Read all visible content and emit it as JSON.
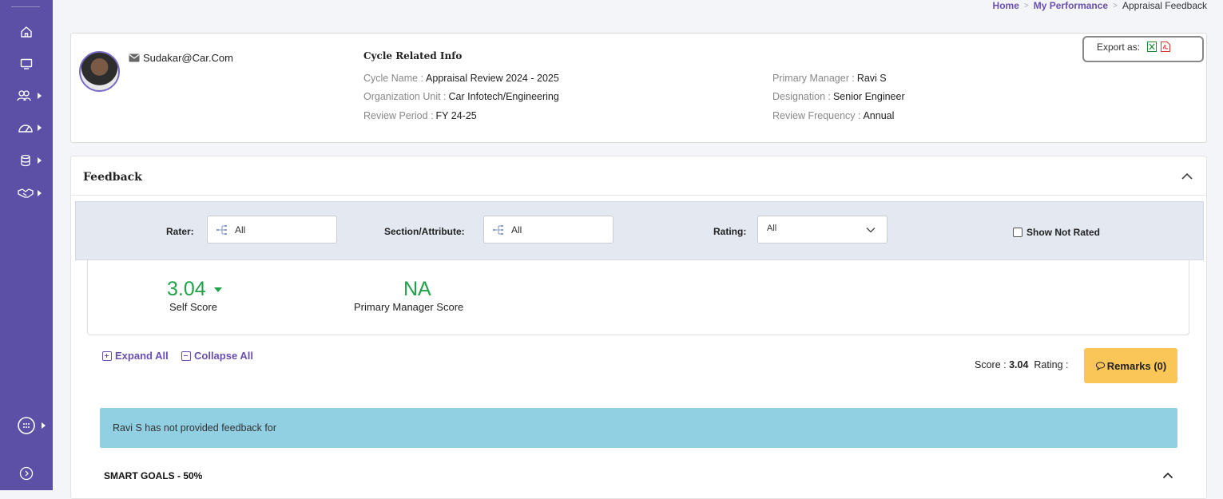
{
  "breadcrumb": {
    "home": "Home",
    "my_performance": "My Performance",
    "current": "Appraisal Feedback",
    "separator": ">"
  },
  "sidebar": {
    "icons": [
      "home-icon",
      "monitor-icon",
      "users-icon",
      "gauge-icon",
      "database-icon",
      "handshake-icon",
      "apps-icon",
      "chevron-right-circle-icon"
    ],
    "color": "#5b4fa6"
  },
  "profile": {
    "email": "Sudakar@Car.Com",
    "cycle_title": "Cycle Related Info",
    "cycle_name_label": "Cycle Name :",
    "cycle_name_value": "Appraisal Review 2024 - 2025",
    "org_unit_label": "Organization Unit :",
    "org_unit_value": "Car Infotech/Engineering",
    "review_period_label": "Review Period :",
    "review_period_value": "FY 24-25",
    "primary_manager_label": "Primary Manager :",
    "primary_manager_value": "Ravi S",
    "designation_label": "Designation :",
    "designation_value": "Senior Engineer",
    "review_freq_label": "Review Frequency :",
    "review_freq_value": "Annual",
    "export_label": "Export as:"
  },
  "feedback": {
    "title": "Feedback",
    "filters": {
      "rater_label": "Rater:",
      "rater_value": "All",
      "section_label": "Section/Attribute:",
      "section_value": "All",
      "rating_label": "Rating:",
      "rating_value": "All",
      "show_not_rated": "Show Not Rated"
    },
    "self_score": "3.04",
    "self_score_label": "Self Score",
    "manager_score": "NA",
    "manager_score_label": "Primary Manager Score",
    "expand_all": "Expand All",
    "collapse_all": "Collapse All",
    "score_label": "Score :",
    "score_value": "3.04",
    "rating_label": "Rating :",
    "remarks_button": "Remarks (0)",
    "alert_text": "Ravi S has not provided feedback for",
    "section_header": "SMART GOALS - 50%"
  },
  "colors": {
    "accent": "#6a4fb3",
    "score_green": "#1fa34a",
    "remarks_bg": "#fbc658",
    "alert_bg": "#91cfe3"
  }
}
